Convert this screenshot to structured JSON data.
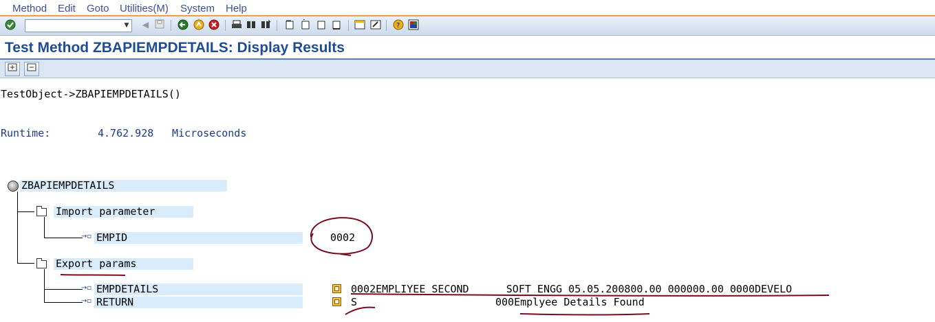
{
  "menu": {
    "items": [
      {
        "label": "Method"
      },
      {
        "label": "Edit"
      },
      {
        "label": "Goto"
      },
      {
        "label": "Utilities(M)"
      },
      {
        "label": "System"
      },
      {
        "label": "Help"
      }
    ]
  },
  "toolbar": {
    "command_value": "",
    "icons": [
      "enter-icon",
      "back-icon",
      "exit-icon",
      "cancel-icon",
      "print-icon",
      "find-icon",
      "find-next-icon",
      "first-page-icon",
      "previous-page-icon",
      "next-page-icon",
      "last-page-icon",
      "new-session-icon",
      "shortcut-icon",
      "help-icon",
      "layout-icon"
    ]
  },
  "title": "Test Method ZBAPIEMPDETAILS: Display Results",
  "content": {
    "test_object": "TestObject->ZBAPIEMPDETAILS()",
    "runtime_label": "Runtime:",
    "runtime_value": "4.762.928",
    "runtime_unit": "Microseconds",
    "root_node": "ZBAPIEMPDETAILS",
    "import_folder": "Import parameter",
    "empid_label": "EMPID",
    "empid_value": "0002",
    "export_folder": "Export params",
    "empdetails_label": "EMPDETAILS",
    "empdetails_value": "0002EMPLIYEE SECOND      SOFT ENGG 05.05.200800.00 000000.00 0000DEVELO",
    "return_label": "RETURN",
    "return_value_type": "S",
    "return_value_msg": "000Emplyee Details Found"
  },
  "colors": {
    "accent": "#1f4c96",
    "highlight": "#d9ecfb",
    "annotation": "#7a0a1e"
  }
}
